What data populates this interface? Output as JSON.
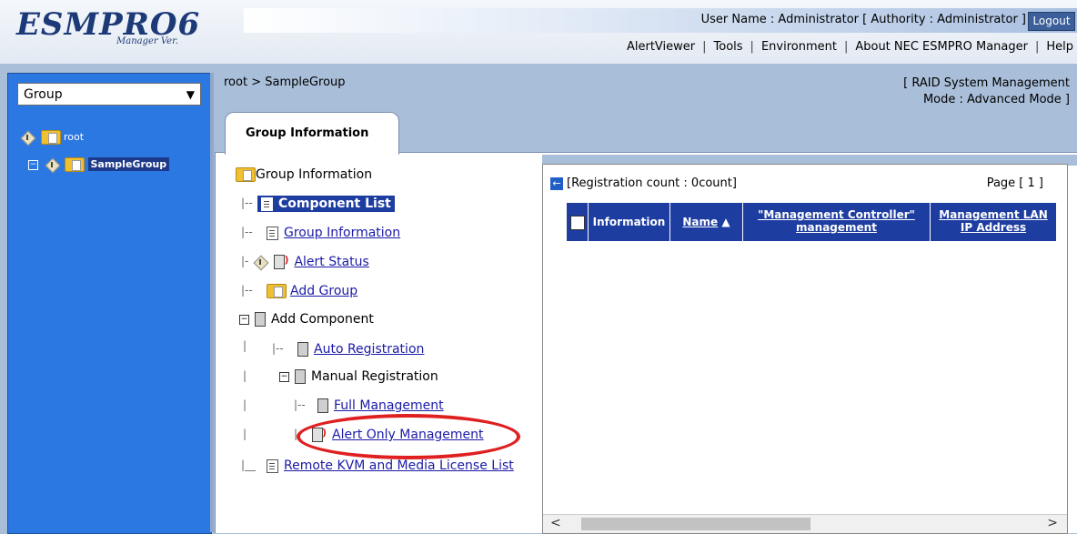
{
  "header": {
    "logo_main": "ESMPRO6",
    "logo_sub": "Manager Ver.",
    "user_text": "User Name : Administrator  [ Authority : Administrator ]",
    "logout": "Logout",
    "menu": [
      "AlertViewer",
      "Tools",
      "Environment",
      "About NEC ESMPRO Manager",
      "Help"
    ]
  },
  "left_pane": {
    "select_value": "Group",
    "tree": {
      "root": "root",
      "child": "SampleGroup"
    }
  },
  "breadcrumb": "root > SampleGroup",
  "raid_mode": {
    "line1": "[ RAID System Management",
    "line2": "Mode : Advanced Mode ]"
  },
  "tab": {
    "label": "Group Information"
  },
  "nav_tree": {
    "root": "Group Information",
    "component_list": "Component List",
    "group_information": "Group Information",
    "alert_status": "Alert Status",
    "add_group": "Add Group",
    "add_component": "Add Component",
    "auto_registration": "Auto Registration",
    "manual_registration": "Manual Registration",
    "full_management": "Full Management",
    "alert_only_management": "Alert Only Management",
    "remote_kvm": "Remote KVM and Media License List"
  },
  "panel": {
    "registration_count": "[Registration count : 0count]",
    "page": "Page [  1  ]",
    "columns": {
      "information": "Information",
      "name": "Name",
      "mgmt_controller_1": "\"Management Controller\"",
      "mgmt_controller_2": "management",
      "mgmt_lan_1": "Management LAN",
      "mgmt_lan_2": "IP Address"
    }
  },
  "colors": {
    "accent": "#1e3da0",
    "left_pane": "#2c78e2",
    "highlight": "#e02020"
  }
}
